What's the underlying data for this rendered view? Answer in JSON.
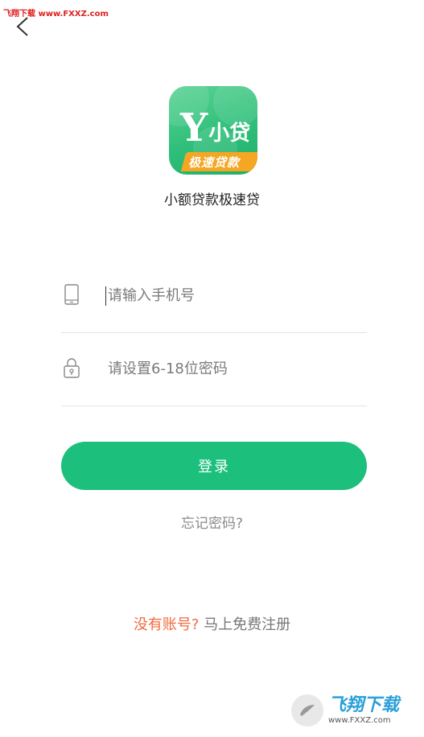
{
  "watermark_top": "飞翔下载 www.FXXZ.com",
  "logo": {
    "letter": "Y",
    "name": "小贷",
    "ribbon": "极速贷款"
  },
  "app_name": "小额贷款极速贷",
  "phone_field": {
    "placeholder": "请输入手机号",
    "icon": "phone-icon"
  },
  "password_field": {
    "placeholder": "请设置6-18位密码",
    "icon": "lock-icon"
  },
  "login_button": "登录",
  "forgot_link": "忘记密码?",
  "register": {
    "question": "没有账号?",
    "link": "马上免费注册"
  },
  "watermark_bottom": {
    "big": "飞翔下载",
    "small": "www.FXXZ.com"
  },
  "colors": {
    "accent": "#1cbf7b",
    "highlight": "#f26a3d"
  }
}
